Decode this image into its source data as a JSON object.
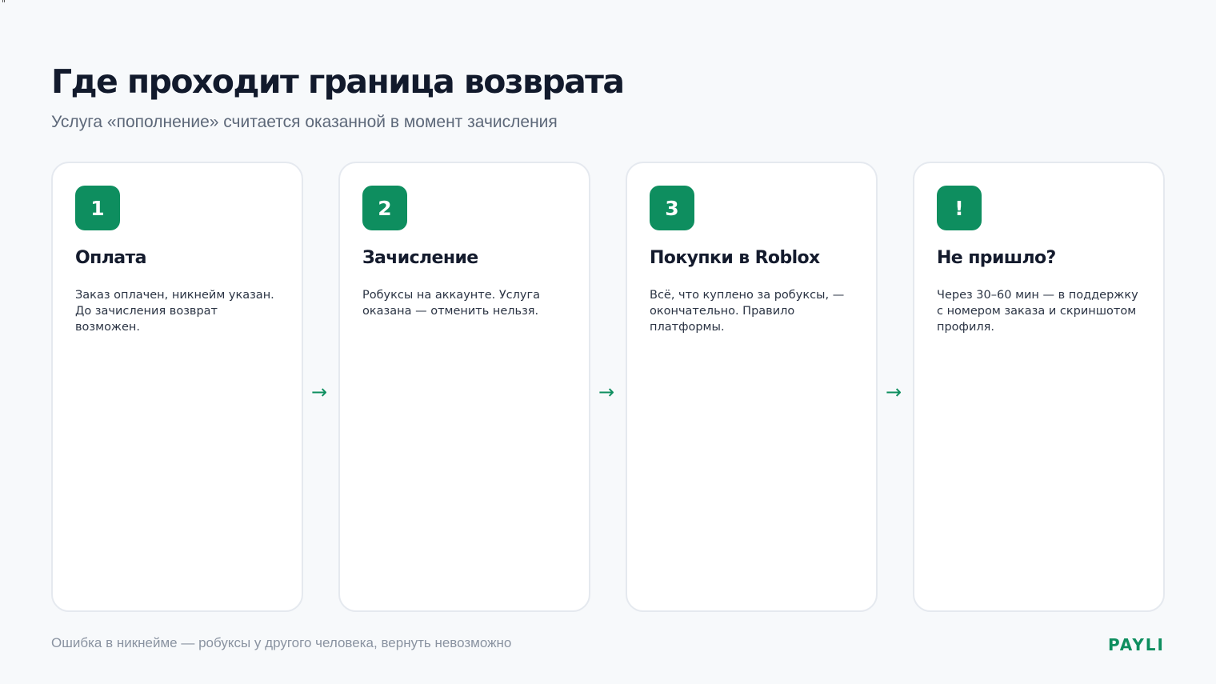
{
  "corner_mark": "\"",
  "header": {
    "title": "Где проходит граница возврата",
    "subtitle": "Услуга «пополнение» считается оказанной в момент зачисления"
  },
  "steps": [
    {
      "badge": "1",
      "title": "Оплата",
      "text": "Заказ оплачен, никнейм указан. До зачисления возврат возможен."
    },
    {
      "badge": "2",
      "title": "Зачисление",
      "text": "Робуксы на аккаунте. Услуга оказана — отменить нельзя."
    },
    {
      "badge": "3",
      "title": "Покупки в Roblox",
      "text": "Всё, что куплено за робуксы, — окончательно. Правило платформы."
    },
    {
      "badge": "!",
      "title": "Не пришло?",
      "text": "Через 30–60 мин — в поддержку с номером заказа и скриншотом профиля."
    }
  ],
  "arrow_glyph": "→",
  "footer": {
    "note": "Ошибка в никнейме — робуксы у другого человека, вернуть невозможно",
    "brand": "PAYLI"
  },
  "colors": {
    "accent": "#0e8e5f",
    "background": "#f7f9fb",
    "card": "#ffffff",
    "title": "#121a2c",
    "muted": "#8a93a1"
  }
}
